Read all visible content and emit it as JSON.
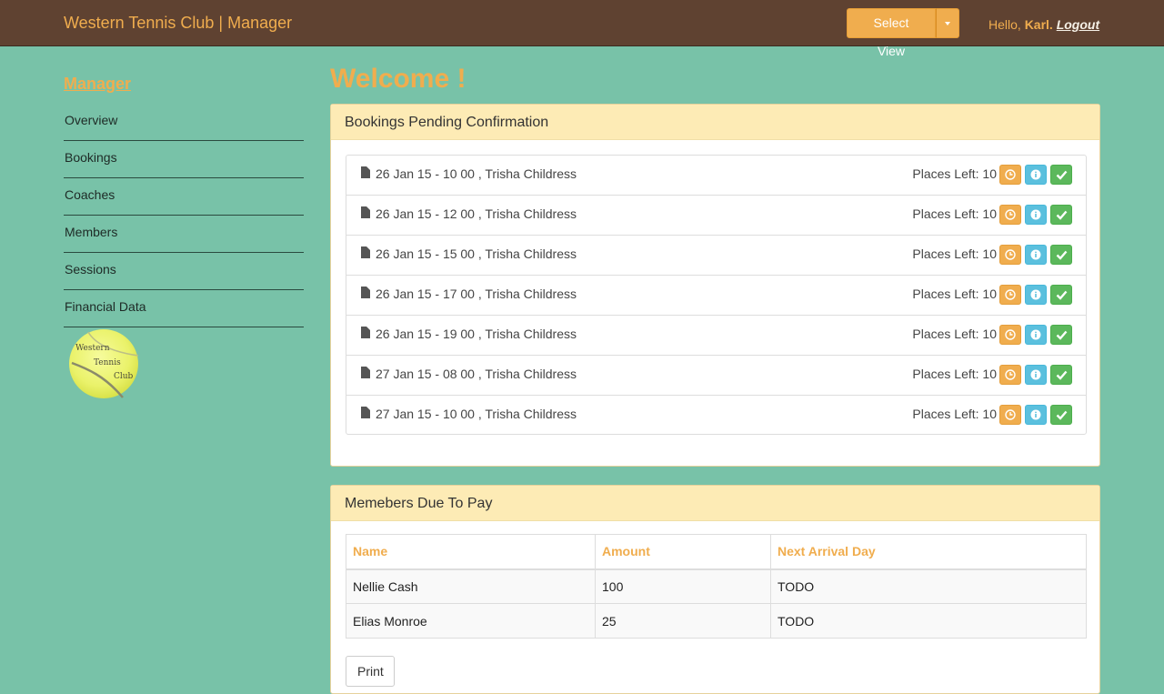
{
  "header": {
    "brand": "Western Tennis Club | Manager",
    "select_view_label": "Select View",
    "greeting": "Hello,",
    "user_name": "Karl.",
    "logout_label": "Logout"
  },
  "sidebar": {
    "title": "Manager",
    "items": [
      {
        "label": "Overview"
      },
      {
        "label": "Bookings"
      },
      {
        "label": "Coaches"
      },
      {
        "label": "Members"
      },
      {
        "label": "Sessions"
      },
      {
        "label": "Financial Data"
      }
    ],
    "logo_lines": [
      "Western",
      "Tennis",
      "Club"
    ]
  },
  "main": {
    "welcome": "Welcome !",
    "pending": {
      "title": "Bookings Pending Confirmation",
      "places_label": "Places Left: 10",
      "rows": [
        {
          "text": "26 Jan 15 - 10 00 , Trisha Childress"
        },
        {
          "text": "26 Jan 15 - 12 00 , Trisha Childress"
        },
        {
          "text": "26 Jan 15 - 15 00 , Trisha Childress"
        },
        {
          "text": "26 Jan 15 - 17 00 , Trisha Childress"
        },
        {
          "text": "26 Jan 15 - 19 00 , Trisha Childress"
        },
        {
          "text": "27 Jan 15 - 08 00 , Trisha Childress"
        },
        {
          "text": "27 Jan 15 - 10 00 , Trisha Childress"
        }
      ]
    },
    "due": {
      "title": "Memebers Due To Pay",
      "columns": [
        "Name",
        "Amount",
        "Next Arrival Day"
      ],
      "rows": [
        [
          "Nellie Cash",
          "100",
          "TODO"
        ],
        [
          "Elias Monroe",
          "25",
          "TODO"
        ]
      ],
      "print_label": "Print"
    }
  },
  "colors": {
    "background": "#78c2a8",
    "navbar": "#5f4231",
    "accent": "#f0ad4e",
    "panel_heading": "#fdebb5",
    "info": "#5bc0de",
    "success": "#5cb85c"
  }
}
